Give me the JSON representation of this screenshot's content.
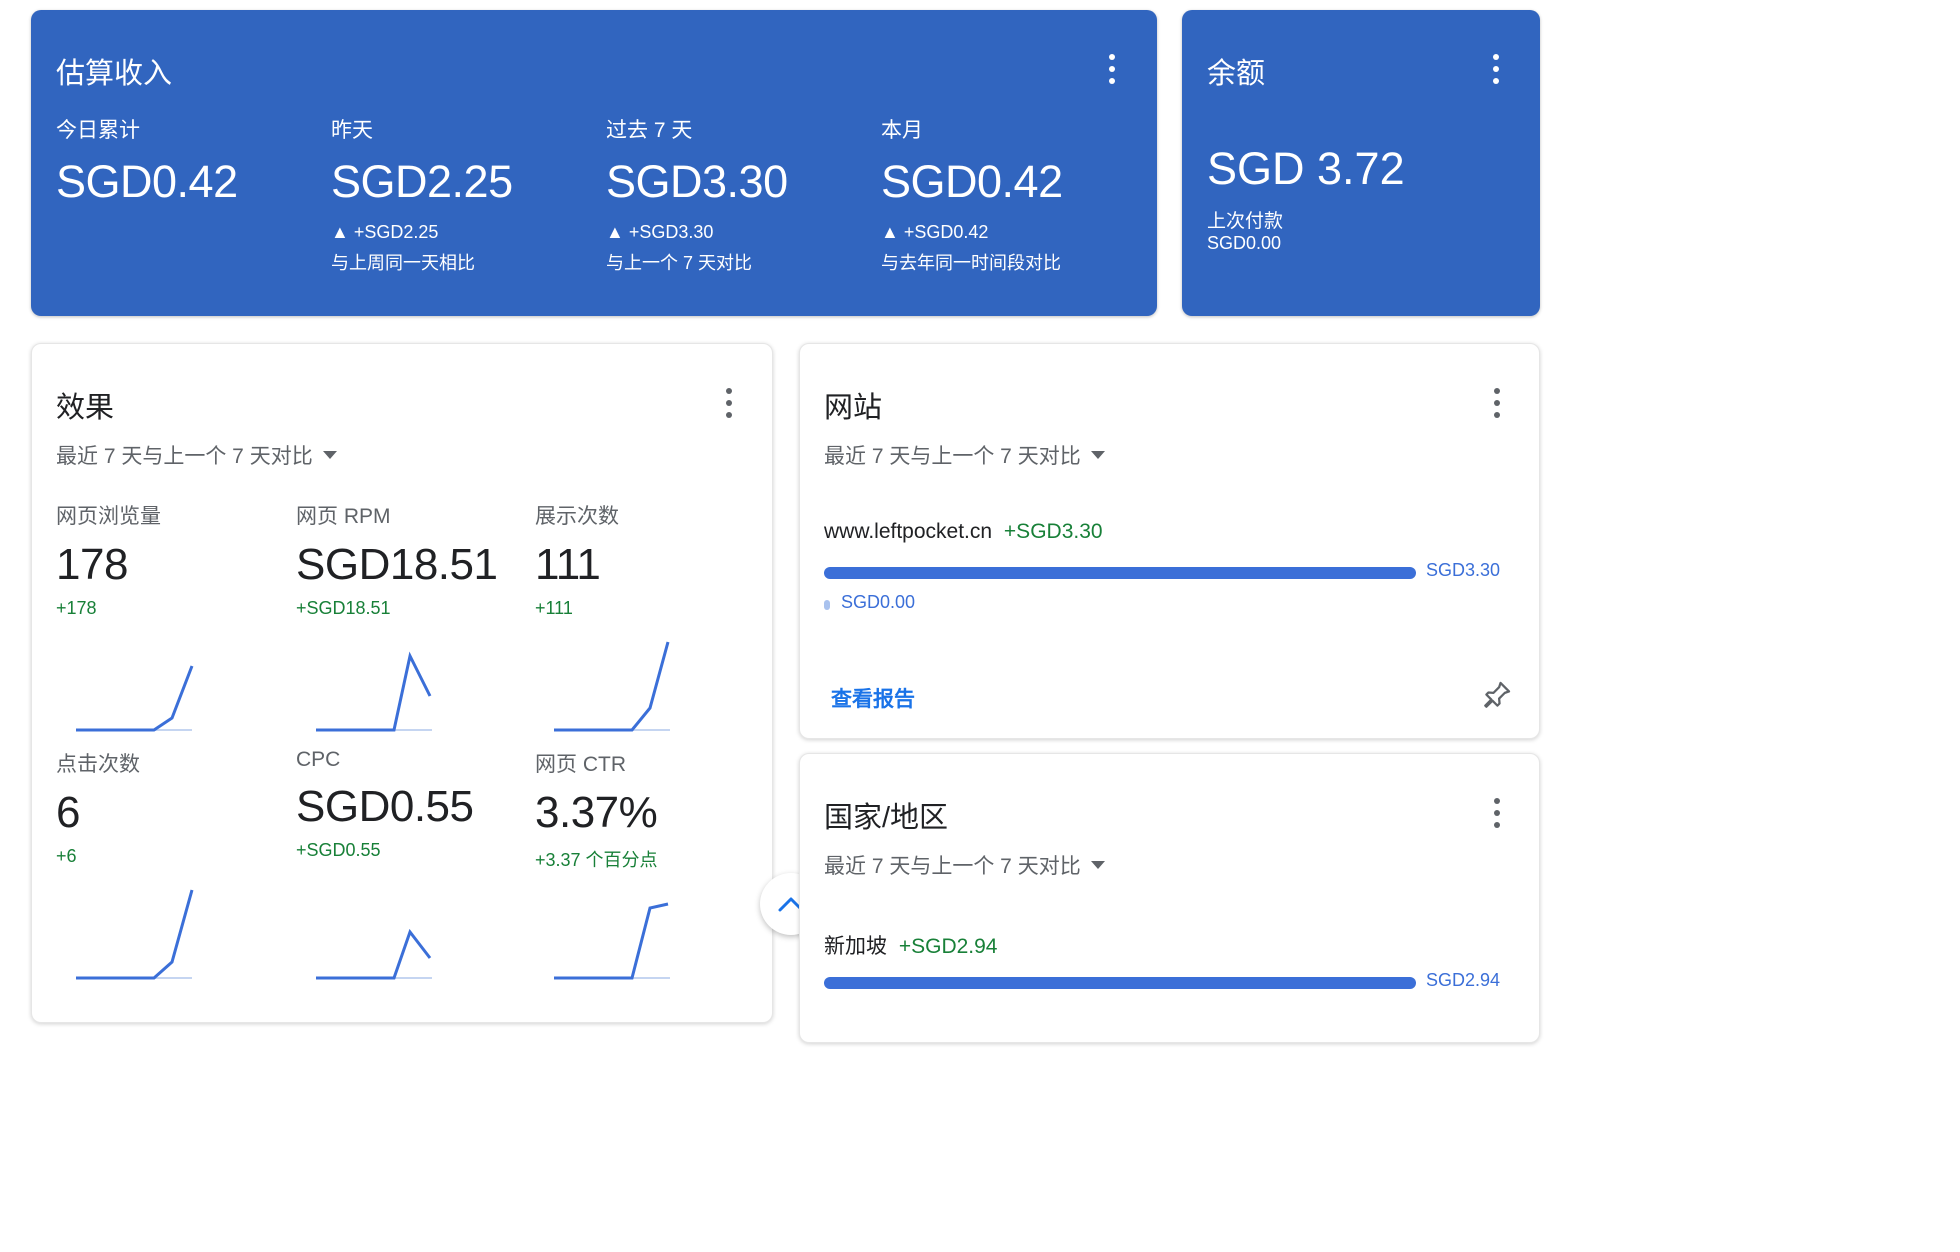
{
  "earnings": {
    "title": "估算收入",
    "metrics": [
      {
        "label": "今日累计",
        "value": "SGD0.42",
        "delta": "",
        "note": ""
      },
      {
        "label": "昨天",
        "value": "SGD2.25",
        "delta": "▲ +SGD2.25",
        "note": "与上周同一天相比"
      },
      {
        "label": "过去 7 天",
        "value": "SGD3.30",
        "delta": "▲ +SGD3.30",
        "note": "与上一个 7 天对比"
      },
      {
        "label": "本月",
        "value": "SGD0.42",
        "delta": "▲ +SGD0.42",
        "note": "与去年同一时间段对比"
      }
    ]
  },
  "balance": {
    "title": "余额",
    "value": "SGD 3.72",
    "last_payment_label": "上次付款",
    "last_payment_value": "SGD0.00"
  },
  "performance": {
    "title": "效果",
    "period": "最近 7 天与上一个 7 天对比",
    "metrics": [
      {
        "label": "网页浏览量",
        "value": "178",
        "delta": "+178"
      },
      {
        "label": "网页 RPM",
        "value": "SGD18.51",
        "delta": "+SGD18.51"
      },
      {
        "label": "展示次数",
        "value": "111",
        "delta": "+111"
      },
      {
        "label": "点击次数",
        "value": "6",
        "delta": "+6"
      },
      {
        "label": "CPC",
        "value": "SGD0.55",
        "delta": "+SGD0.55"
      },
      {
        "label": "网页 CTR",
        "value": "3.37%",
        "delta": "+3.37 个百分点"
      }
    ]
  },
  "sites": {
    "title": "网站",
    "period": "最近 7 天与上一个 7 天对比",
    "site_name": "www.leftpocket.cn",
    "site_delta": "+SGD3.30",
    "current_value": "SGD3.30",
    "previous_value": "SGD0.00",
    "view_report": "查看报告"
  },
  "countries": {
    "title": "国家/地区",
    "period": "最近 7 天与上一个 7 天对比",
    "country_name": "新加坡",
    "country_delta": "+SGD2.94",
    "current_value": "SGD2.94"
  },
  "colors": {
    "primary_blue": "#3165bf",
    "positive_green": "#188038",
    "bar_blue": "#3b6fd8"
  },
  "icons": {
    "more": "more-vert-icon",
    "dropdown": "arrow-drop-down-icon",
    "pin": "pin-icon",
    "scroll_top": "chevron-up-icon"
  }
}
